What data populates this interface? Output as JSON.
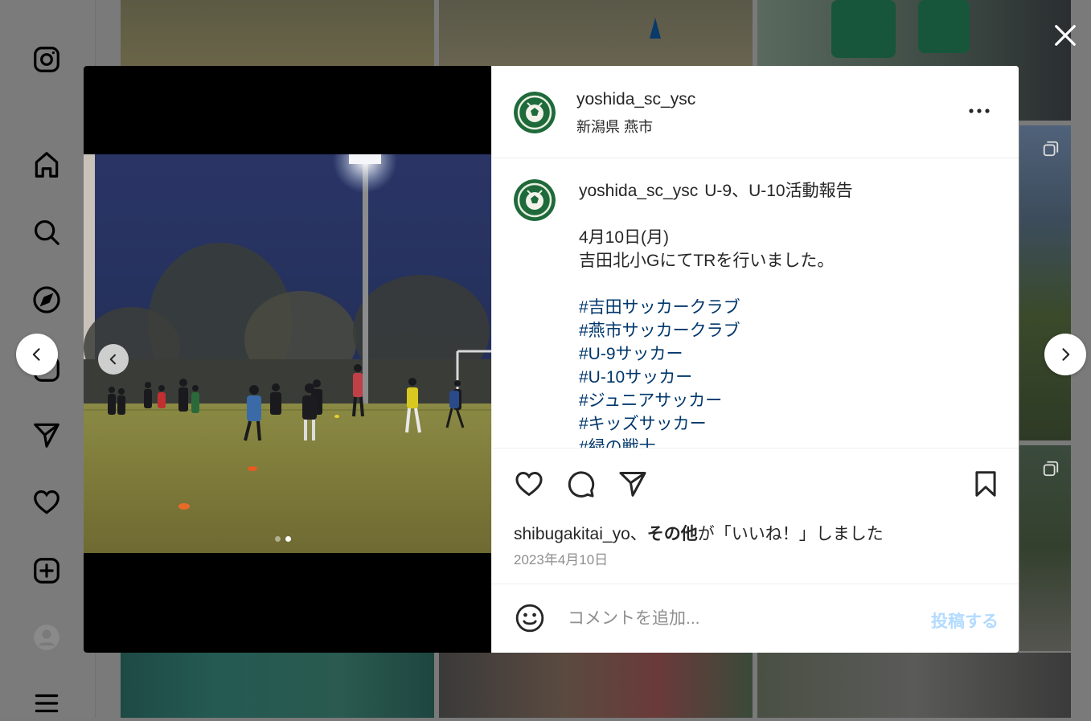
{
  "sidebar": {
    "icons": [
      "instagram-logo-icon",
      "home-icon",
      "search-icon",
      "explore-icon",
      "reels-icon",
      "direct-icon",
      "heart-icon",
      "create-icon",
      "profile-avatar",
      "menu-icon"
    ]
  },
  "post": {
    "username": "yoshida_sc_ysc",
    "location": "新潟県 燕市",
    "caption_username": "yoshida_sc_ysc",
    "caption_lines": [
      {
        "text": "U-9、U-10活動報告",
        "type": "text"
      },
      {
        "text": "",
        "type": "blank"
      },
      {
        "text": "4月10日(月)",
        "type": "text"
      },
      {
        "text": "吉田北小GにてTRを行いました。",
        "type": "text"
      },
      {
        "text": "",
        "type": "blank"
      },
      {
        "text": "#吉田サッカークラブ",
        "type": "tag"
      },
      {
        "text": "#燕市サッカークラブ",
        "type": "tag"
      },
      {
        "text": "#U-9サッカー",
        "type": "tag"
      },
      {
        "text": "#U-10サッカー",
        "type": "tag"
      },
      {
        "text": "#ジュニアサッカー",
        "type": "tag"
      },
      {
        "text": "#キッズサッカー",
        "type": "tag"
      },
      {
        "text": "#緑の戦士",
        "type": "tag"
      }
    ],
    "liked_by_user": "shibugakitai_yo",
    "liked_by_sep": "、",
    "liked_by_others": "その他",
    "liked_by_suffix": "が「いいね！」しました",
    "date": "2023年4月10日",
    "comment_placeholder": "コメントを追加...",
    "post_button": "投稿する",
    "carousel": {
      "count": 2,
      "active": 1
    }
  },
  "colors": {
    "hashtag": "#00376b",
    "post_button_disabled": "#b3dbff",
    "secondary_text": "#8e8e8e"
  }
}
